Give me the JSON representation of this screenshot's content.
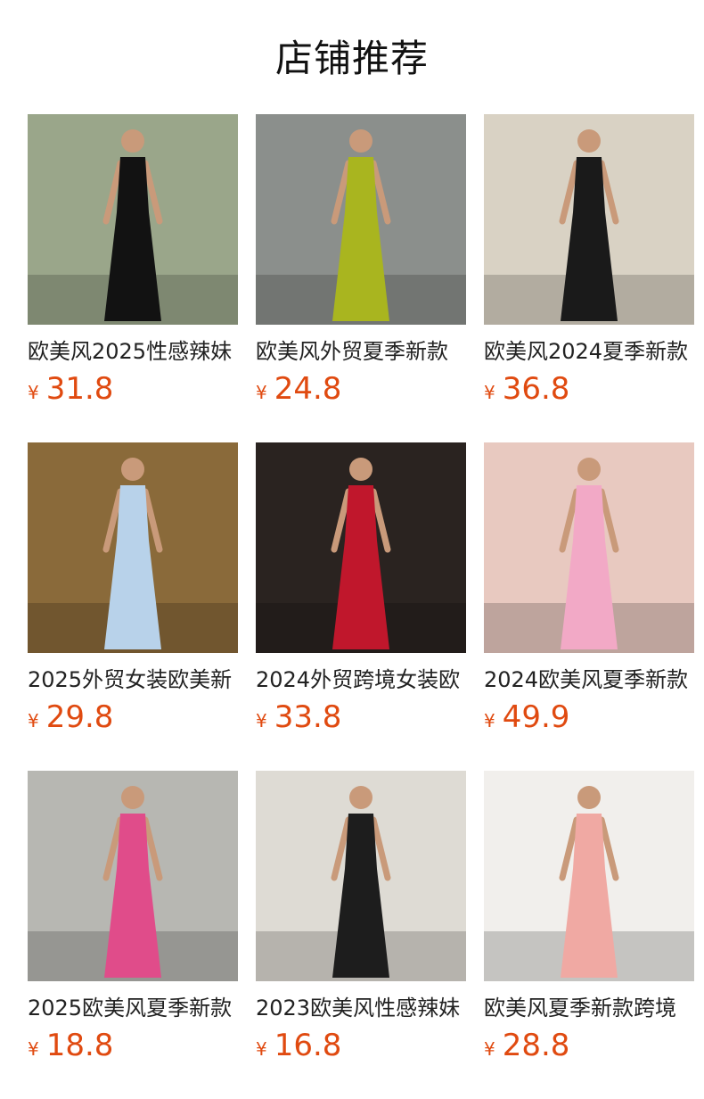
{
  "header": {
    "title": "店铺推荐"
  },
  "products": [
    {
      "name": "欧美风2025性感辣妹",
      "currency": "¥",
      "price": "31.8",
      "image": "dress-black-halter-icon",
      "dress_color": "#121212",
      "bg_color": "#9aa68a"
    },
    {
      "name": "欧美风外贸夏季新款",
      "currency": "¥",
      "price": "24.8",
      "image": "dress-lime-maxi-icon",
      "dress_color": "#a9b51f",
      "bg_color": "#8b8f8c"
    },
    {
      "name": "欧美风2024夏季新款",
      "currency": "¥",
      "price": "36.8",
      "image": "dress-black-cowl-icon",
      "dress_color": "#1a1a1a",
      "bg_color": "#d9d2c4"
    },
    {
      "name": "2025外贸女装欧美新",
      "currency": "¥",
      "price": "29.8",
      "image": "dress-light-blue-icon",
      "dress_color": "#b8d2ea",
      "bg_color": "#8a6a3a"
    },
    {
      "name": "2024外贸跨境女装欧",
      "currency": "¥",
      "price": "33.8",
      "image": "dress-red-slit-icon",
      "dress_color": "#c0172c",
      "bg_color": "#2a2320"
    },
    {
      "name": "2024欧美风夏季新款",
      "currency": "¥",
      "price": "49.9",
      "image": "dress-pink-black-ruffle-icon",
      "dress_color": "#f2a9c6",
      "bg_color": "#e8c9c0"
    },
    {
      "name": "2025欧美风夏季新款",
      "currency": "¥",
      "price": "18.8",
      "image": "dress-hot-pink-ruffle-icon",
      "dress_color": "#e04c8a",
      "bg_color": "#b7b7b2"
    },
    {
      "name": "2023欧美风性感辣妹",
      "currency": "¥",
      "price": "16.8",
      "image": "black-top-jeans-icon",
      "dress_color": "#1d1d1d",
      "bg_color": "#dedbd4"
    },
    {
      "name": "欧美风夏季新款跨境",
      "currency": "¥",
      "price": "28.8",
      "image": "pink-set-ruffle-skirt-icon",
      "dress_color": "#f0a9a3",
      "bg_color": "#f1efec"
    }
  ]
}
